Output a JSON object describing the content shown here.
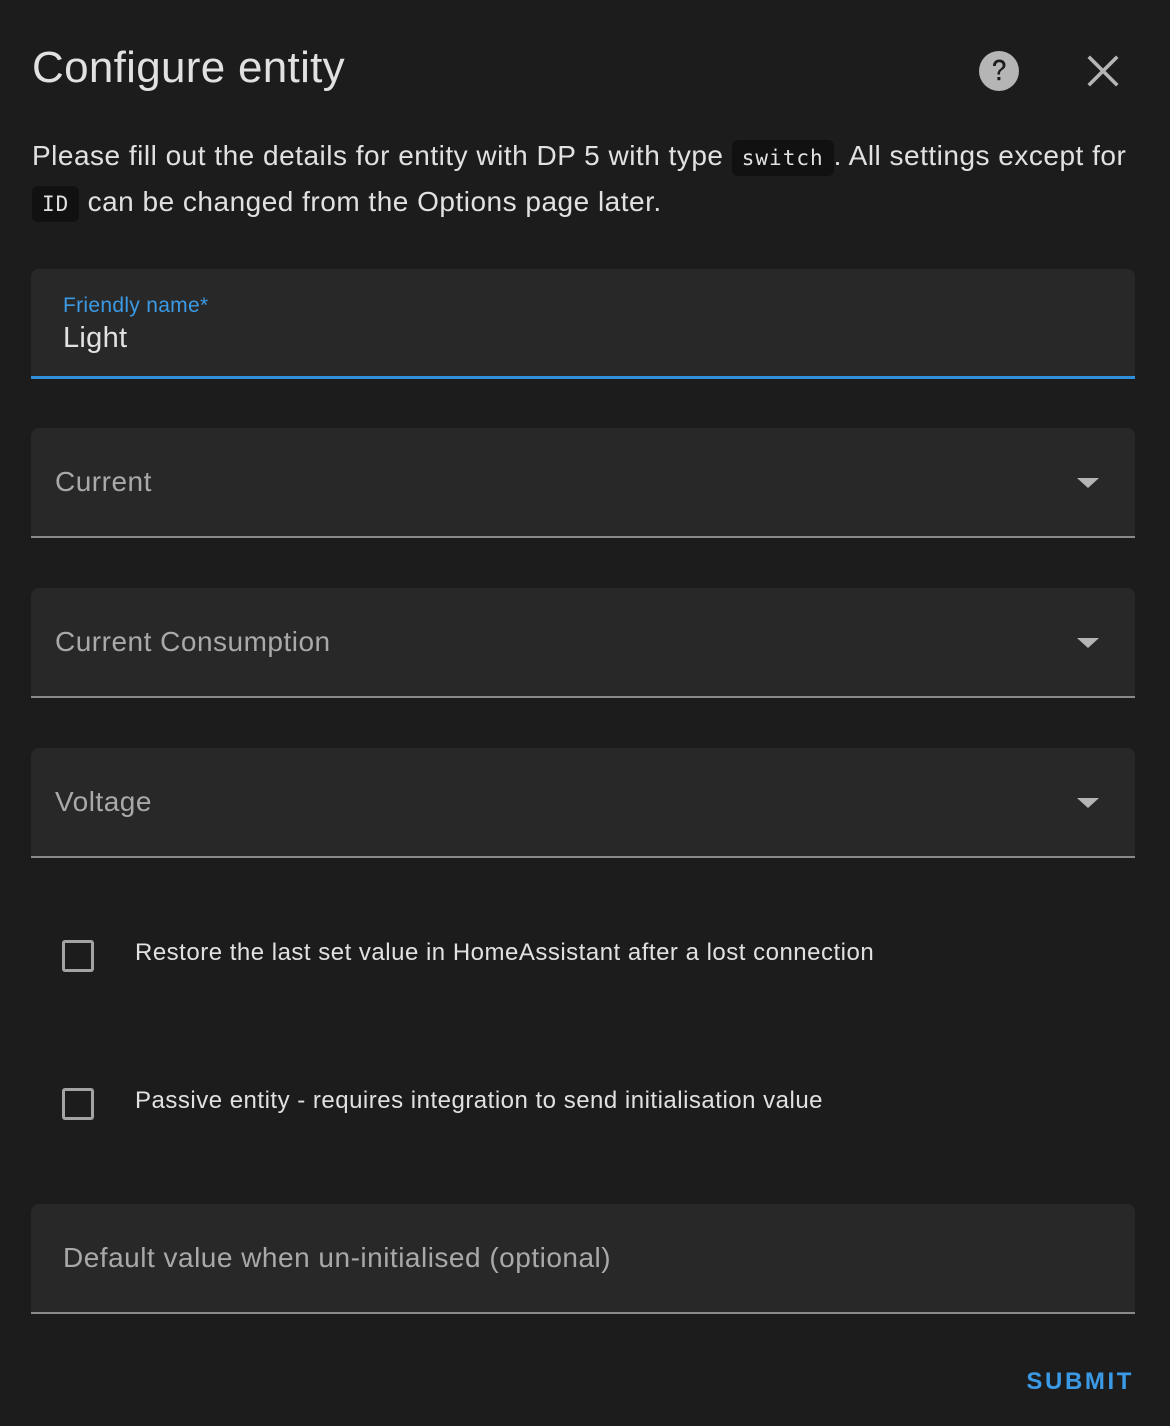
{
  "dialog": {
    "title": "Configure entity",
    "help_icon": "help-circle-icon",
    "close_icon": "close-icon"
  },
  "description": {
    "part1": "Please fill out the details for entity with DP 5 with type ",
    "code1": "switch",
    "part2": ". All settings except for ",
    "code2": "ID",
    "part3": " can be changed from the Options page later."
  },
  "fields": {
    "friendly_name": {
      "label": "Friendly name*",
      "value": "Light"
    },
    "current": {
      "label": "Current"
    },
    "current_consumption": {
      "label": "Current Consumption"
    },
    "voltage": {
      "label": "Voltage"
    },
    "restore_on_reconnect": {
      "label": "Restore the last set value in HomeAssistant after a lost connection",
      "checked": false
    },
    "passive_entity": {
      "label": "Passive entity - requires integration to send initialisation value",
      "checked": false
    },
    "default_value": {
      "label": "Default value when un-initialised (optional)",
      "value": ""
    }
  },
  "actions": {
    "submit_label": "SUBMIT"
  },
  "colors": {
    "background": "#1c1c1c",
    "field_background": "#282828",
    "accent": "#3b9ae6",
    "text_primary": "#e1e1e1",
    "text_secondary": "#a9a9a9"
  }
}
